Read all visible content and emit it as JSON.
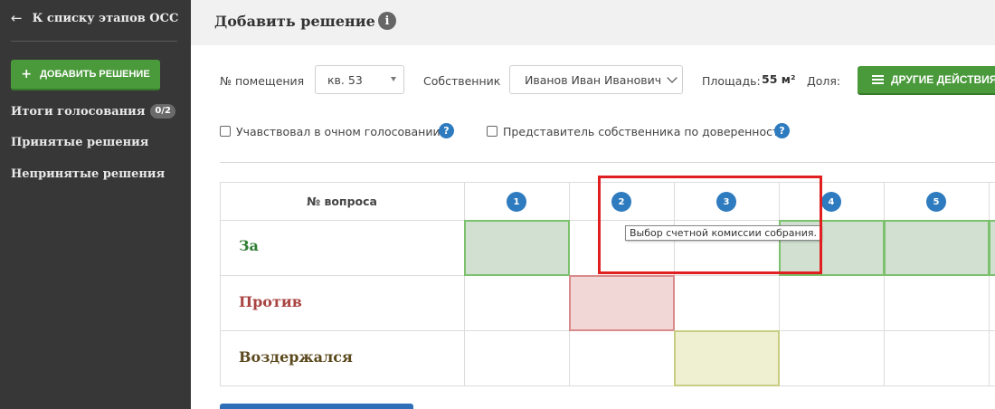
{
  "sidebar": {
    "back_label": "К списку этапов ОСС",
    "add_button_label": "ДОБАВИТЬ РЕШЕНИЕ",
    "items": [
      {
        "label": "Итоги голосования",
        "badge": "0/2"
      },
      {
        "label": "Принятые решения"
      },
      {
        "label": "Непринятые решения"
      }
    ]
  },
  "header": {
    "title": "Добавить решение"
  },
  "form": {
    "room_label": "№ помещения",
    "room_value": "кв. 53",
    "owner_label": "Собственник",
    "owner_value": "Иванов Иван Иванович",
    "area_label": "Площадь:",
    "area_value": "55 м²",
    "share_label": "Доля:",
    "other_actions_label": "ДРУГИЕ ДЕЙСТВИЯ",
    "checkbox_attended": "Учавствовал в очном голосовании",
    "checkbox_proxy": "Представитель собственника по доверенности"
  },
  "table": {
    "header_label": "№ вопроса",
    "questions": [
      "1",
      "2",
      "3",
      "4",
      "5"
    ],
    "rows": [
      {
        "label": "За",
        "color": "#2e7d32",
        "selected": [
          "1",
          "4",
          "5"
        ]
      },
      {
        "label": "Против",
        "color": "#a94442",
        "selected": [
          "2"
        ]
      },
      {
        "label": "Воздержался",
        "color": "#5c4a1e",
        "selected": [
          "3"
        ]
      }
    ]
  },
  "tooltip": "Выбор счетной комиссии собрания.",
  "colors": {
    "sidebar_bg": "#373737",
    "green_button": "#4a9a3b",
    "blue_badge": "#2e7bbf",
    "highlight": "#e02020"
  }
}
